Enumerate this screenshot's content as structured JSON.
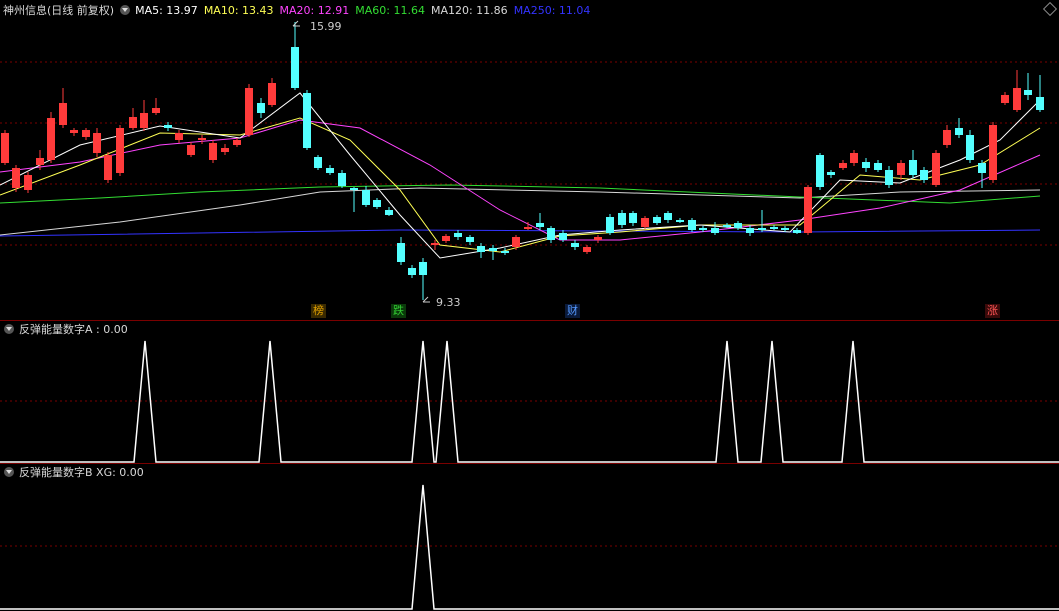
{
  "main": {
    "stock_label": "神州信息(日线 前复权)",
    "ma": [
      {
        "label": "MA5: 13.97",
        "color": "#ffffff"
      },
      {
        "label": "MA10: 13.43",
        "color": "#ffff55"
      },
      {
        "label": "MA20: 12.91",
        "color": "#ff44ff"
      },
      {
        "label": "MA60: 11.64",
        "color": "#33dd33"
      },
      {
        "label": "MA120: 11.86",
        "color": "#d8d8d8"
      },
      {
        "label": "MA250: 11.04",
        "color": "#3333ff"
      }
    ],
    "high_label": "15.99",
    "low_label": "9.33",
    "tags": [
      {
        "text": "榜",
        "color": "#e0a000"
      },
      {
        "text": "跌",
        "color": "#33cc33"
      },
      {
        "text": "财",
        "color": "#5599ff"
      },
      {
        "text": "涨",
        "color": "#ff5555"
      }
    ]
  },
  "ind1": {
    "title": "反弹能量数字A : 0.00"
  },
  "ind2": {
    "title": "反弹能量数字B XG: 0.00"
  },
  "colors": {
    "up": "#ff3b3b",
    "down": "#54ffff",
    "grid": "#7a0000",
    "line": "#ffffff"
  }
}
